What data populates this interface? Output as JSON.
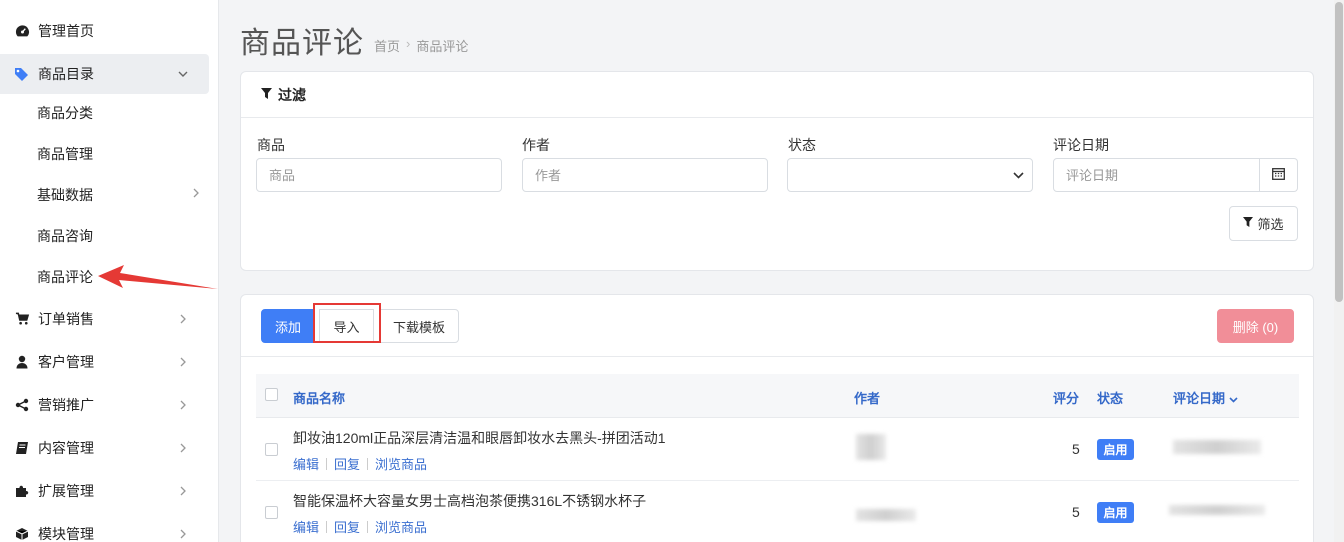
{
  "sidebar": {
    "items": [
      {
        "label": "管理首页",
        "icon": "dashboard-icon"
      },
      {
        "label": "商品目录",
        "icon": "tags-icon"
      },
      {
        "label": "订单销售",
        "icon": "cart-icon"
      },
      {
        "label": "客户管理",
        "icon": "user-icon"
      },
      {
        "label": "营销推广",
        "icon": "share-icon"
      },
      {
        "label": "内容管理",
        "icon": "book-icon"
      },
      {
        "label": "扩展管理",
        "icon": "puzzle-icon"
      },
      {
        "label": "模块管理",
        "icon": "cube-icon"
      }
    ],
    "subitems": [
      {
        "label": "商品分类"
      },
      {
        "label": "商品管理"
      },
      {
        "label": "基础数据"
      },
      {
        "label": "商品咨询"
      },
      {
        "label": "商品评论"
      }
    ]
  },
  "header": {
    "title": "商品评论",
    "breadcrumb": [
      "首页",
      "商品评论"
    ]
  },
  "filter": {
    "title": "过滤",
    "product_label": "商品",
    "product_placeholder": "商品",
    "author_label": "作者",
    "author_placeholder": "作者",
    "status_label": "状态",
    "status_value": "",
    "date_label": "评论日期",
    "date_placeholder": "评论日期",
    "filter_button": "筛选"
  },
  "toolbar": {
    "add": "添加",
    "import": "导入",
    "template": "下载模板",
    "delete": "删除 (0)"
  },
  "table": {
    "columns": {
      "name": "商品名称",
      "author": "作者",
      "score": "评分",
      "status": "状态",
      "date": "评论日期"
    },
    "rows": [
      {
        "name": "卸妆油120ml正品深层清洁温和眼唇卸妆水去黑头-拼团活动1",
        "score": "5",
        "status": "启用"
      },
      {
        "name": "智能保温杯大容量女男士高档泡茶便携316L不锈钢水杯子",
        "score": "5",
        "status": "启用"
      }
    ],
    "row_actions": {
      "edit": "编辑",
      "reply": "回复",
      "view": "浏览商品"
    }
  },
  "colors": {
    "primary": "#3f7ef6",
    "danger_light": "#f18e98",
    "highlight": "#e53935",
    "link": "#3b6fd0"
  }
}
